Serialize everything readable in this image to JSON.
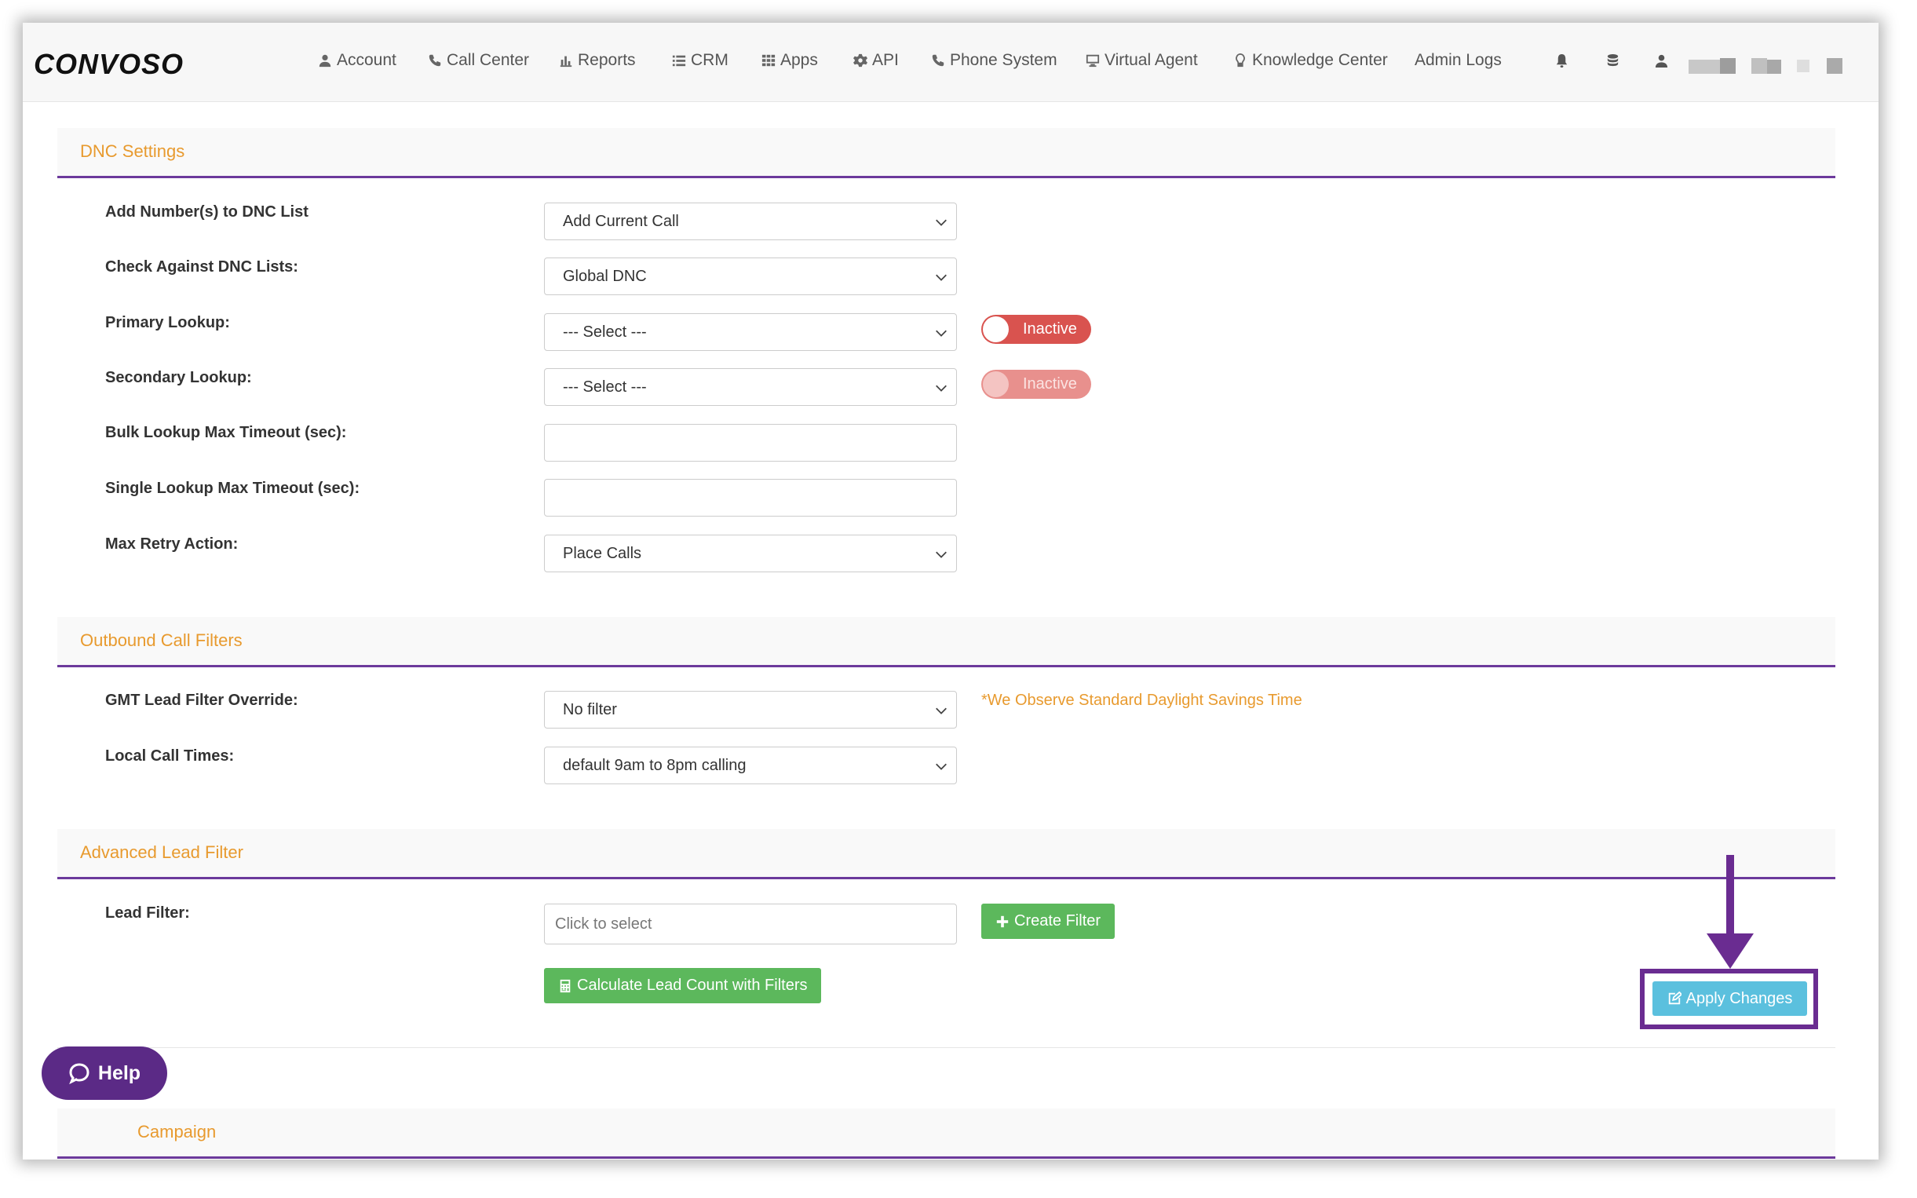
{
  "brand": {
    "logo_text": "CONVOSO"
  },
  "nav": {
    "items": [
      {
        "label": "Account",
        "icon": "user-icon"
      },
      {
        "label": "Call Center",
        "icon": "phone-icon"
      },
      {
        "label": "Reports",
        "icon": "bar-chart-icon"
      },
      {
        "label": "CRM",
        "icon": "list-icon"
      },
      {
        "label": "Apps",
        "icon": "grid-icon"
      },
      {
        "label": "API",
        "icon": "gear-icon"
      },
      {
        "label": "Phone System",
        "icon": "phone-icon"
      },
      {
        "label": "Virtual Agent",
        "icon": "monitor-icon"
      },
      {
        "label": "Knowledge Center",
        "icon": "lightbulb-icon"
      },
      {
        "label": "Admin Logs",
        "icon": ""
      }
    ],
    "right_icons": [
      "bell-icon",
      "database-icon",
      "user-icon"
    ]
  },
  "dnc": {
    "title": "DNC Settings",
    "add_numbers_label": "Add Number(s) to DNC List",
    "add_numbers_value": "Add Current Call",
    "check_lists_label": "Check Against DNC Lists:",
    "check_lists_value": "Global DNC",
    "primary_label": "Primary Lookup:",
    "primary_value": "--- Select ---",
    "primary_status": "Inactive",
    "secondary_label": "Secondary Lookup:",
    "secondary_value": "--- Select ---",
    "secondary_status": "Inactive",
    "bulk_timeout_label": "Bulk Lookup Max Timeout (sec):",
    "single_timeout_label": "Single Lookup Max Timeout (sec):",
    "max_retry_label": "Max Retry Action:",
    "max_retry_value": "Place Calls"
  },
  "outbound": {
    "title": "Outbound Call Filters",
    "gmt_label": "GMT Lead Filter Override:",
    "gmt_value": "No filter",
    "dst_note": "*We Observe Standard Daylight Savings Time",
    "local_times_label": "Local Call Times:",
    "local_times_value": "default 9am to 8pm calling"
  },
  "advanced": {
    "title": "Advanced Lead Filter",
    "lead_filter_label": "Lead Filter:",
    "lead_filter_placeholder": "Click to select",
    "create_filter": "Create Filter",
    "calc_count": "Calculate Lead Count with Filters"
  },
  "actions": {
    "apply": "Apply Changes"
  },
  "next_section": {
    "title": "Campaign"
  },
  "help": {
    "label": "Help"
  },
  "colors": {
    "accent_orange": "#e89a2e",
    "divider_purple": "#6c3a9c",
    "toggle_red": "#d9534f",
    "green": "#5cb85c",
    "info_blue": "#5bc0de",
    "help_purple": "#5b2a86"
  }
}
